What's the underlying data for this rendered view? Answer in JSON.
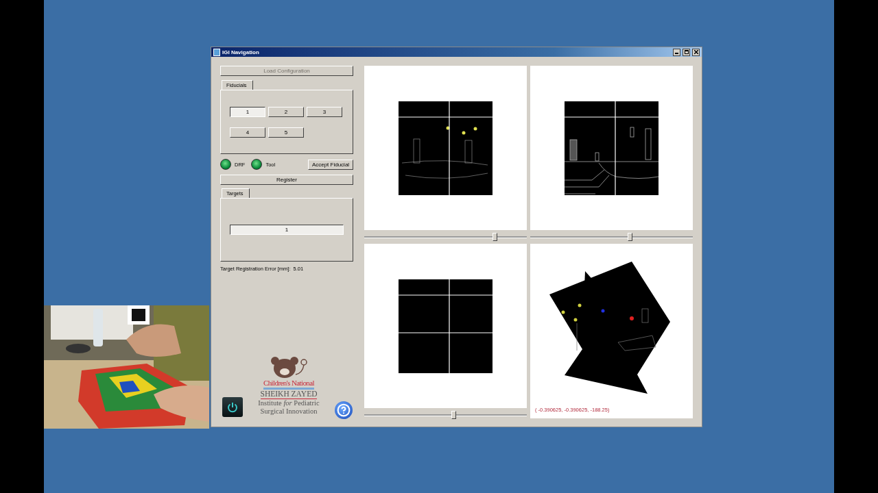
{
  "window": {
    "title": "IGI Navigation"
  },
  "left_panel": {
    "load_button": {
      "label": "Load Configuration",
      "disabled": true
    },
    "fiducials_tab": {
      "label": "Fiducials",
      "selected": true
    },
    "fiducial_buttons": [
      {
        "label": "1",
        "selected": true
      },
      {
        "label": "2",
        "selected": false
      },
      {
        "label": "3",
        "selected": false
      },
      {
        "label": "4",
        "selected": false
      },
      {
        "label": "5",
        "selected": false
      }
    ],
    "indicators": [
      {
        "label": "DRF",
        "on": true
      },
      {
        "label": "Tool",
        "on": true
      }
    ],
    "accept_button": "Accept Fiducial",
    "register_button": "Register",
    "targets_tab": {
      "label": "Targets",
      "selected": true
    },
    "target_buttons": [
      {
        "label": "1",
        "selected": true
      }
    ],
    "tre": {
      "label": "Target Registration Error [mm]:",
      "value": "5.01"
    },
    "logo": {
      "lines": [
        "Children's National",
        "SHEIKH ZAYED",
        "Institute *for* Pediatric",
        "Surgical Innovation"
      ]
    }
  },
  "views": [
    {
      "kind": "slice",
      "slider": {
        "level": 0.8
      }
    },
    {
      "kind": "slice",
      "slider": {
        "level": 0.61
      }
    },
    {
      "kind": "slice",
      "slider": {
        "level": 0.55
      }
    },
    {
      "kind": "volume",
      "coordinates": "( -0.390625, -0.390625, -188.25)"
    }
  ]
}
